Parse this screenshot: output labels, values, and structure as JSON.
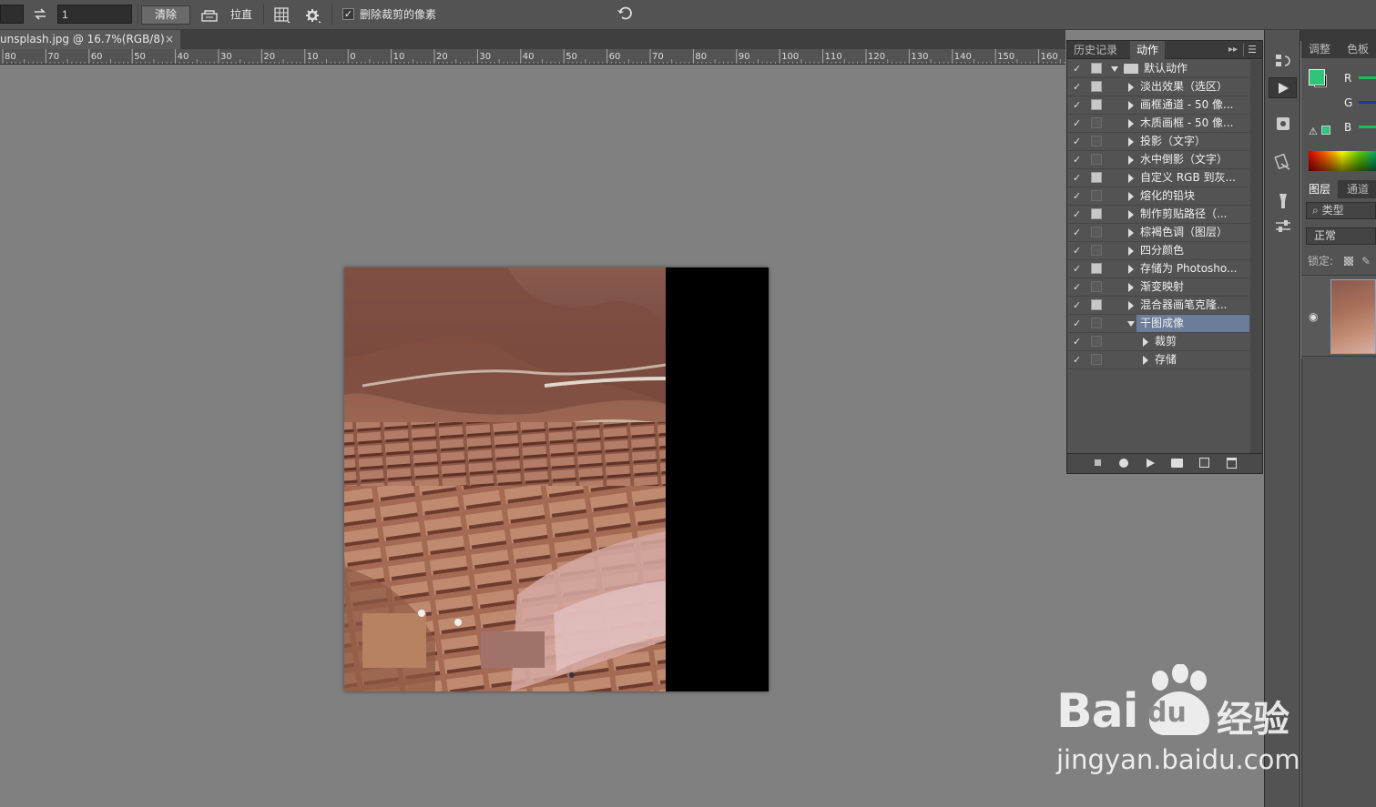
{
  "options_bar": {
    "ratio_value": "1",
    "clear_label": "清除",
    "straighten_label": "拉直",
    "delete_cropped_label": "删除裁剪的像素",
    "delete_cropped_checked": true
  },
  "document_tab": {
    "title": "unsplash.jpg @ 16.7%(RGB/8)",
    "close_glyph": "×"
  },
  "ruler": {
    "labels": [
      "80",
      "70",
      "60",
      "50",
      "40",
      "30",
      "20",
      "10",
      "0",
      "10",
      "20",
      "30",
      "40",
      "50",
      "60",
      "70",
      "80",
      "90",
      "100",
      "110",
      "120",
      "130",
      "140",
      "150",
      "160"
    ]
  },
  "actions_panel": {
    "tabs": [
      {
        "label": "历史记录",
        "active": false
      },
      {
        "label": "动作",
        "active": true
      }
    ],
    "rows": [
      {
        "label": "默认动作",
        "checked": true,
        "dialog": true,
        "kind": "set",
        "expanded": true,
        "level": 0
      },
      {
        "label": "淡出效果（选区）",
        "checked": true,
        "dialog": true,
        "kind": "action",
        "expanded": false,
        "level": 1
      },
      {
        "label": "画框通道 - 50 像...",
        "checked": true,
        "dialog": true,
        "kind": "action",
        "expanded": false,
        "level": 1
      },
      {
        "label": "木质画框 - 50 像...",
        "checked": true,
        "dialog": false,
        "kind": "action",
        "expanded": false,
        "level": 1
      },
      {
        "label": "投影（文字）",
        "checked": true,
        "dialog": false,
        "kind": "action",
        "expanded": false,
        "level": 1
      },
      {
        "label": "水中倒影（文字）",
        "checked": true,
        "dialog": false,
        "kind": "action",
        "expanded": false,
        "level": 1
      },
      {
        "label": "自定义 RGB 到灰...",
        "checked": true,
        "dialog": true,
        "kind": "action",
        "expanded": false,
        "level": 1
      },
      {
        "label": "熔化的铅块",
        "checked": true,
        "dialog": false,
        "kind": "action",
        "expanded": false,
        "level": 1
      },
      {
        "label": "制作剪贴路径（...",
        "checked": true,
        "dialog": true,
        "kind": "action",
        "expanded": false,
        "level": 1
      },
      {
        "label": "棕褐色调（图层）",
        "checked": true,
        "dialog": false,
        "kind": "action",
        "expanded": false,
        "level": 1
      },
      {
        "label": "四分颜色",
        "checked": true,
        "dialog": false,
        "kind": "action",
        "expanded": false,
        "level": 1
      },
      {
        "label": "存储为 Photosho...",
        "checked": true,
        "dialog": true,
        "kind": "action",
        "expanded": false,
        "level": 1
      },
      {
        "label": "渐变映射",
        "checked": true,
        "dialog": false,
        "kind": "action",
        "expanded": false,
        "level": 1
      },
      {
        "label": "混合器画笔克隆...",
        "checked": true,
        "dialog": true,
        "kind": "action",
        "expanded": false,
        "level": 1
      },
      {
        "label": "干图成像",
        "checked": true,
        "dialog": false,
        "kind": "action",
        "expanded": true,
        "level": 1,
        "selected": true
      },
      {
        "label": "裁剪",
        "checked": true,
        "dialog": false,
        "kind": "step",
        "expanded": false,
        "level": 2
      },
      {
        "label": "存储",
        "checked": true,
        "dialog": false,
        "kind": "step",
        "expanded": false,
        "level": 2
      }
    ]
  },
  "color_panel": {
    "tabs": [
      "调整",
      "色板"
    ],
    "channels": [
      "R",
      "G",
      "B"
    ],
    "foreground_color": "#2fc47a",
    "background_color": "#000000"
  },
  "layers_panel": {
    "tabs": [
      "图层",
      "通道"
    ],
    "filter_placeholder": "类型",
    "blend_mode": "正常",
    "lock_label": "锁定:"
  },
  "watermark": {
    "brand": "Bai",
    "brand2": "du",
    "suffix": "经验",
    "url": "jingyan.baidu.com"
  }
}
